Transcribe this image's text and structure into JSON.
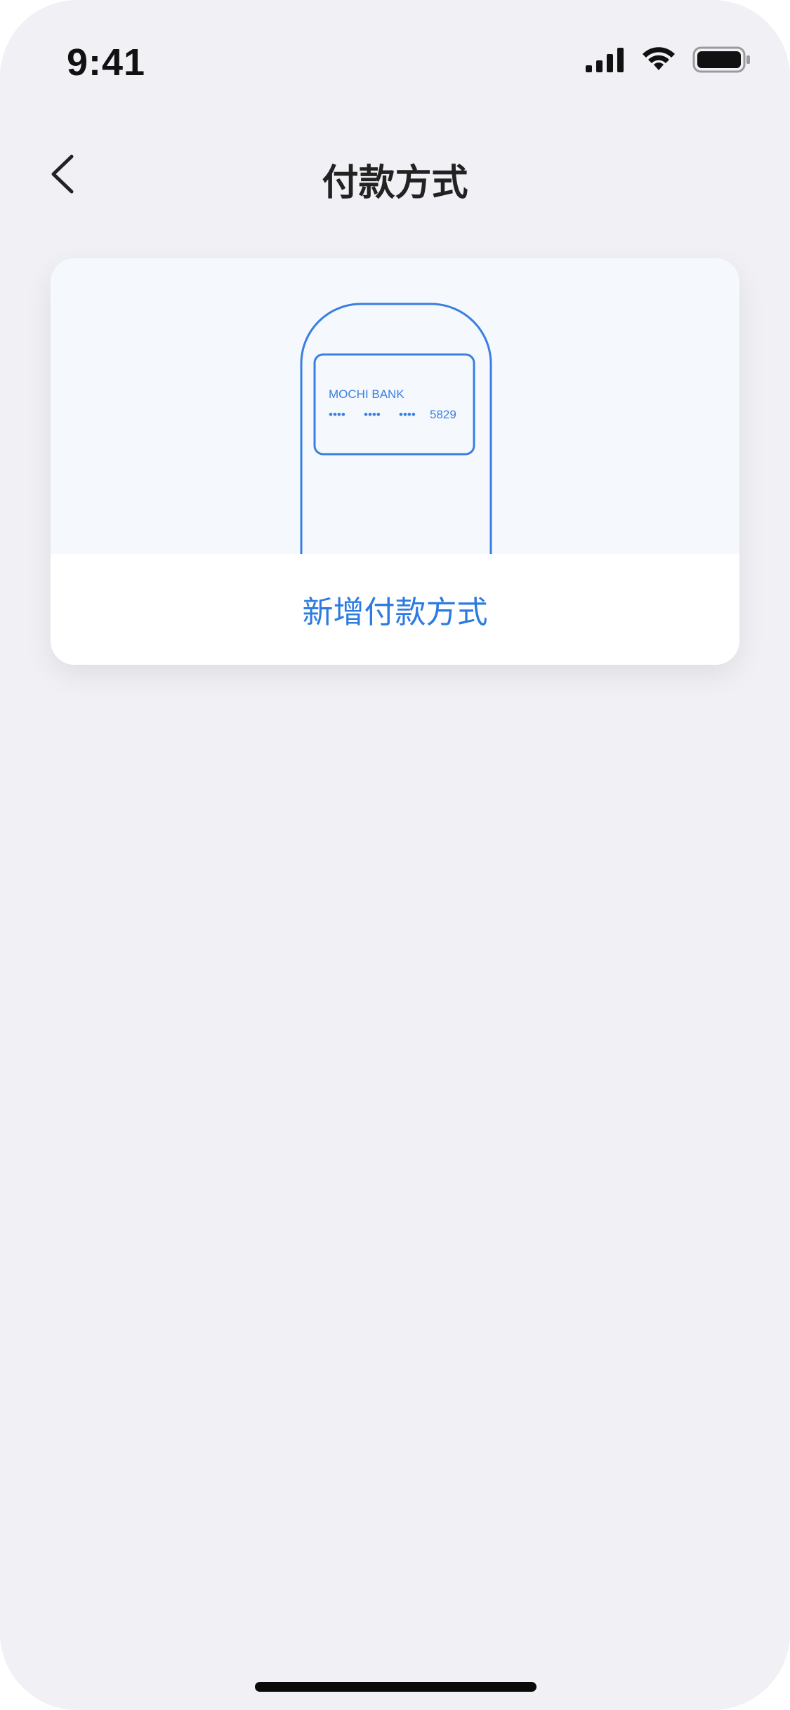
{
  "status_bar": {
    "time": "9:41",
    "icons": [
      "cellular-signal-icon",
      "wifi-icon",
      "battery-icon"
    ]
  },
  "nav": {
    "back_icon": "chevron-left-icon",
    "title": "付款方式"
  },
  "card": {
    "illustration": {
      "bank_name": "MOCHI BANK",
      "masked_groups": [
        "••••",
        "••••",
        "••••"
      ],
      "last_four": "5829"
    },
    "add_button_label": "新增付款方式"
  },
  "colors": {
    "background": "#F0F0F5",
    "accent": "#2B7BE0",
    "illustration_bg": "#F5F9FD",
    "title": "#222222"
  }
}
